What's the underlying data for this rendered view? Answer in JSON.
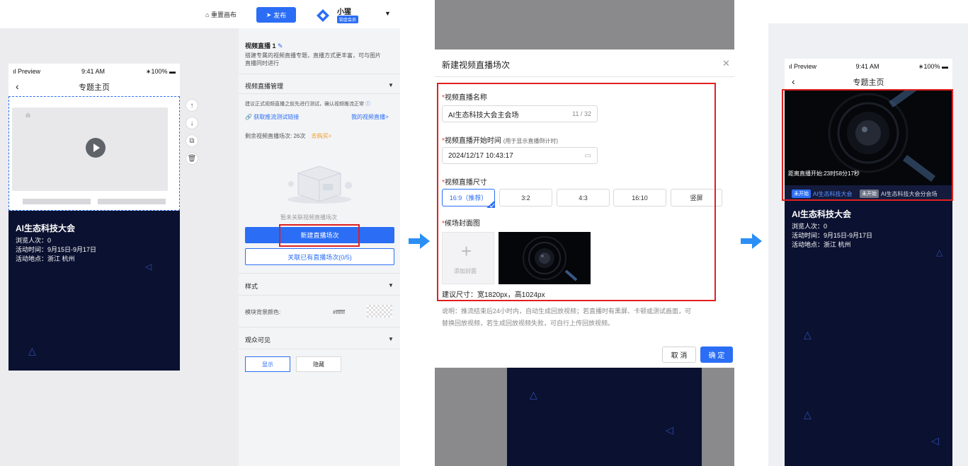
{
  "header": {
    "reset_label": "重置画布",
    "publish_label": "发布",
    "user_name": "小猩",
    "user_badge": "铂金会员"
  },
  "phone": {
    "status_left": "Preview",
    "status_time": "9:41 AM",
    "status_battery": "100%",
    "nav_title": "专题主页",
    "event_title": "AI生态科技大会",
    "views_label": "浏览人次：0",
    "time_label": "活动时间：9月15日-9月17日",
    "location_label": "活动地点：浙江 杭州"
  },
  "settings": {
    "module_title": "视频直播 1",
    "module_desc_1": "搭建专属的视频直播专题，直播方式更丰富，可与图片",
    "module_desc_2": "直播同时进行",
    "manage_title": "视频直播管理",
    "tip_1": "建议正式视频直播之前先进行测试，确认视频推流正常",
    "get_link": "获取推流测试链接",
    "my_live": "我的视频直播>",
    "remain_label": "剩余视频直播场次: 26次",
    "buy_link": "去购买>",
    "empty_text": "暂未关联视频直播场次",
    "new_btn": "新建直播场次",
    "link_btn": "关联已有直播场次(0/5)",
    "style_title": "样式",
    "bg_color_label": "模块背景颜色:",
    "bg_color_value": "#ffffff",
    "visible_title": "观众可见",
    "show_label": "显示",
    "hide_label": "隐藏"
  },
  "dialog": {
    "title": "新建视频直播场次",
    "name_label": "视频直播名称",
    "name_value": "AI生态科技大会主会场",
    "name_count": "11 / 32",
    "start_label": "视频直播开始时间",
    "start_hint": "(用于显示直播倒计时)",
    "start_value": "2024/12/17 10:43:17",
    "size_label": "视频直播尺寸",
    "sizes": [
      "16:9（推荐）",
      "3:2",
      "4:3",
      "16:10",
      "竖屏"
    ],
    "cover_label": "候场封面图",
    "add_cover": "添加封面",
    "cover_hint": "建议尺寸：宽1820px，高1024px",
    "note_1": "说明：推流结束后24小时内，自动生成回放视频；若直播时有黑屏、卡顿或测试画面，可",
    "note_2": "替换回放视频，若生成回放视频失败，可自行上传回放视频。",
    "cancel": "取 消",
    "confirm": "确 定"
  },
  "result": {
    "countdown": "距离直播开始:23时58分17秒",
    "tab1_badge": "未开始",
    "tab1_label": "AI生态科技大会",
    "tab2_badge": "未开始",
    "tab2_label": "AI生态科技大会分会场"
  },
  "colors": {
    "accent": "#2b6ef5",
    "highlight": "#e02020",
    "phone_bg": "#0b1130"
  }
}
